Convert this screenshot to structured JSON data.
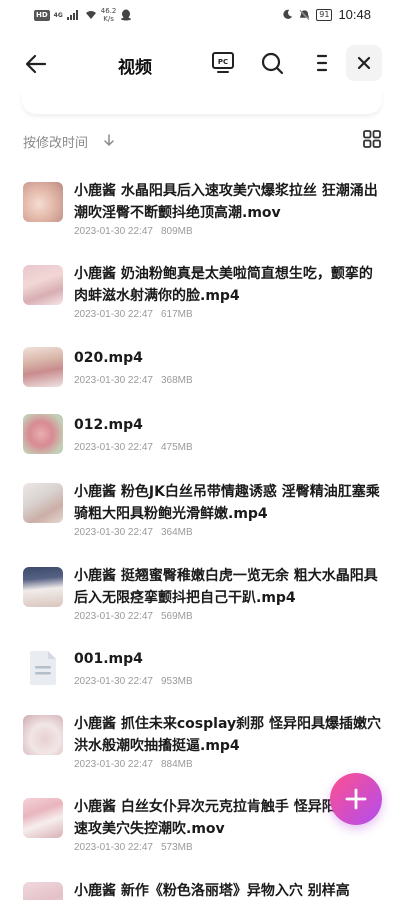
{
  "status_bar": {
    "hd": "HD",
    "network": "4G",
    "speed": "46.2\nK/s",
    "time": "10:48",
    "battery": "91"
  },
  "header": {
    "title": "视频",
    "pc_label": "PC"
  },
  "sort": {
    "label": "按修改时间"
  },
  "files": [
    {
      "name": "小鹿酱 水晶阳具后入速攻美穴爆浆拉丝 狂潮涌出潮吹淫臀不断颤抖绝顶高潮.mov",
      "date": "2023-01-30 22:47",
      "size": "809MB",
      "thumb": "photo-a"
    },
    {
      "name": "小鹿酱 奶油粉鲍真是太美啦简直想生吃，颤挛的肉蚌滋水射满你的脸.mp4",
      "date": "2023-01-30 22:47",
      "size": "617MB",
      "thumb": "photo-b"
    },
    {
      "name": "020.mp4",
      "date": "2023-01-30 22:47",
      "size": "368MB",
      "thumb": "photo-c"
    },
    {
      "name": "012.mp4",
      "date": "2023-01-30 22:47",
      "size": "475MB",
      "thumb": "photo-d"
    },
    {
      "name": "小鹿酱 粉色JK白丝吊带情趣诱惑 淫臀精油肛塞乘骑粗大阳具粉鲍光滑鲜嫩.mp4",
      "date": "2023-01-30 22:47",
      "size": "364MB",
      "thumb": "photo-e"
    },
    {
      "name": "小鹿酱 挺翘蜜臀稚嫩白虎一览无余 粗大水晶阳具后入无限痉挛颤抖把自己干趴.mp4",
      "date": "2023-01-30 22:47",
      "size": "569MB",
      "thumb": "photo-f"
    },
    {
      "name": "001.mp4",
      "date": "2023-01-30 22:47",
      "size": "953MB",
      "thumb": "generic-file-icon"
    },
    {
      "name": "小鹿酱 抓住未来cosplay刹那 怪异阳具爆插嫩穴洪水般潮吹抽搐挺逼.mp4",
      "date": "2023-01-30 22:47",
      "size": "884MB",
      "thumb": "photo-g"
    },
    {
      "name": "小鹿酱 白丝女仆异次元克拉肯触手 怪异阳具吸盘速攻美穴失控潮吹.mov",
      "date": "2023-01-30 22:47",
      "size": "573MB",
      "thumb": "photo-h"
    },
    {
      "name": "小鹿酱 新作《粉色洛丽塔》异物入穴 别样高",
      "date": "",
      "size": "",
      "thumb": "photo-i"
    }
  ],
  "colors": {
    "fab_start": "#ff4f8e",
    "fab_end": "#b04ef0",
    "meta_text": "#9a9a9a",
    "sort_text": "#8a8a8a"
  }
}
